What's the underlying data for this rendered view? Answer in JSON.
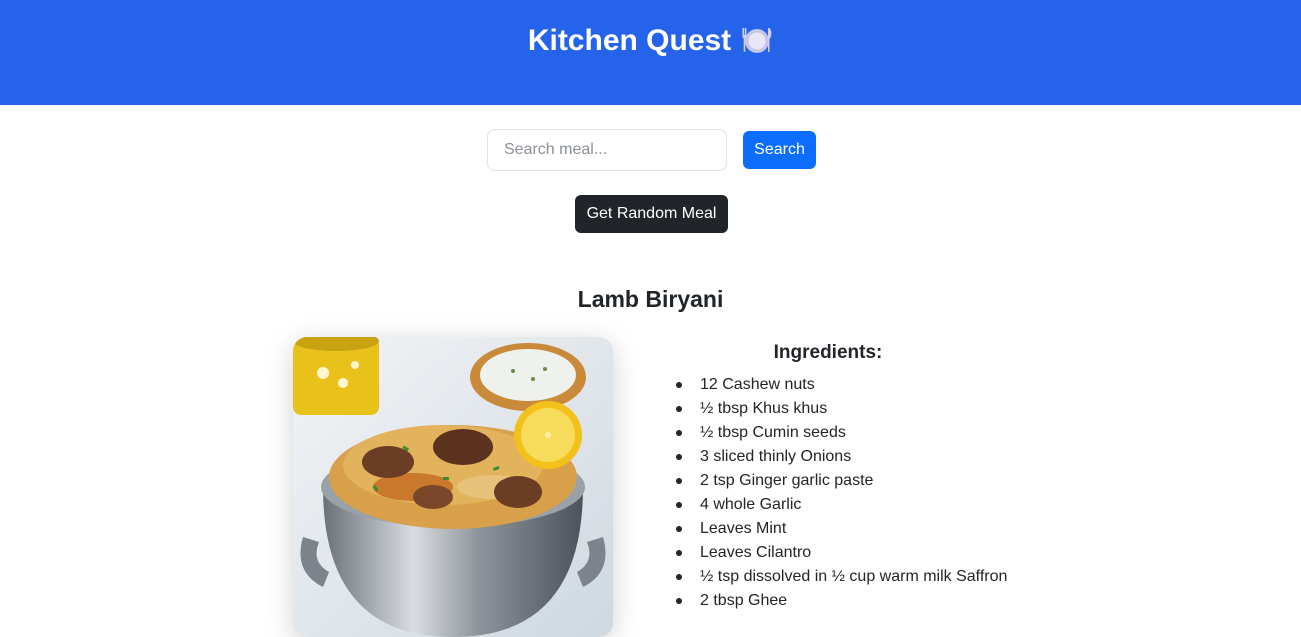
{
  "header": {
    "title": "Kitchen Quest",
    "icon": "plate-with-cutlery-icon",
    "background_color": "#2563eb"
  },
  "search": {
    "placeholder": "Search meal...",
    "value": "",
    "button_label": "Search",
    "button_color": "#0d6efd"
  },
  "random": {
    "button_label": "Get Random Meal",
    "button_color": "#212529"
  },
  "meal": {
    "name": "Lamb Biryani",
    "image_alt": "Lamb Biryani",
    "ingredients_heading": "Ingredients:",
    "ingredients": [
      "12 Cashew nuts",
      "½ tbsp Khus khus",
      "½ tbsp Cumin seeds",
      "3 sliced thinly Onions",
      "2 tsp Ginger garlic paste",
      "4 whole Garlic",
      "Leaves Mint",
      "Leaves Cilantro",
      "½ tsp dissolved in ½ cup warm milk Saffron",
      "2 tbsp Ghee"
    ]
  }
}
